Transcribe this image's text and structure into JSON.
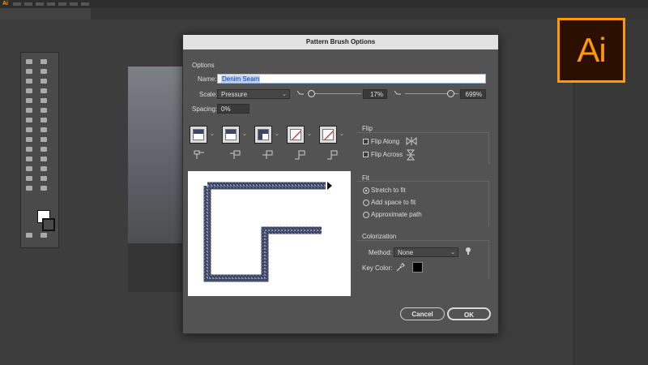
{
  "app": {
    "mini_logo": "Ai"
  },
  "logo": {
    "text": "Ai",
    "color": "#ff9a00"
  },
  "dialog": {
    "title": "Pattern Brush Options",
    "options_heading": "Options",
    "name_label": "Name:",
    "name_value": "Denim Seam",
    "scale_label": "Scale:",
    "scale_value": "Pressure",
    "scale_min": "17%",
    "scale_max": "699%",
    "spacing_label": "Spacing:",
    "spacing_value": "0%",
    "flip": {
      "heading": "Flip",
      "along_label": "Flip Along",
      "across_label": "Flip Across",
      "along_checked": false,
      "across_checked": false
    },
    "fit": {
      "heading": "Fit",
      "options": [
        "Stretch to fit",
        "Add space to fit",
        "Approximate path"
      ],
      "selected": "Stretch to fit"
    },
    "colorization": {
      "heading": "Colorization",
      "method_label": "Method:",
      "method_value": "None",
      "key_color_label": "Key Color:",
      "key_color": "#000000"
    },
    "tiles": [
      "side-tile",
      "outer-corner-tile",
      "inner-corner-tile",
      "start-tile-none",
      "end-tile-none"
    ],
    "buttons": {
      "cancel": "Cancel",
      "ok": "OK"
    }
  },
  "colors": {
    "dialog_bg": "#535353",
    "title_bg": "#e2e2e2",
    "denim": "#3c4664"
  }
}
